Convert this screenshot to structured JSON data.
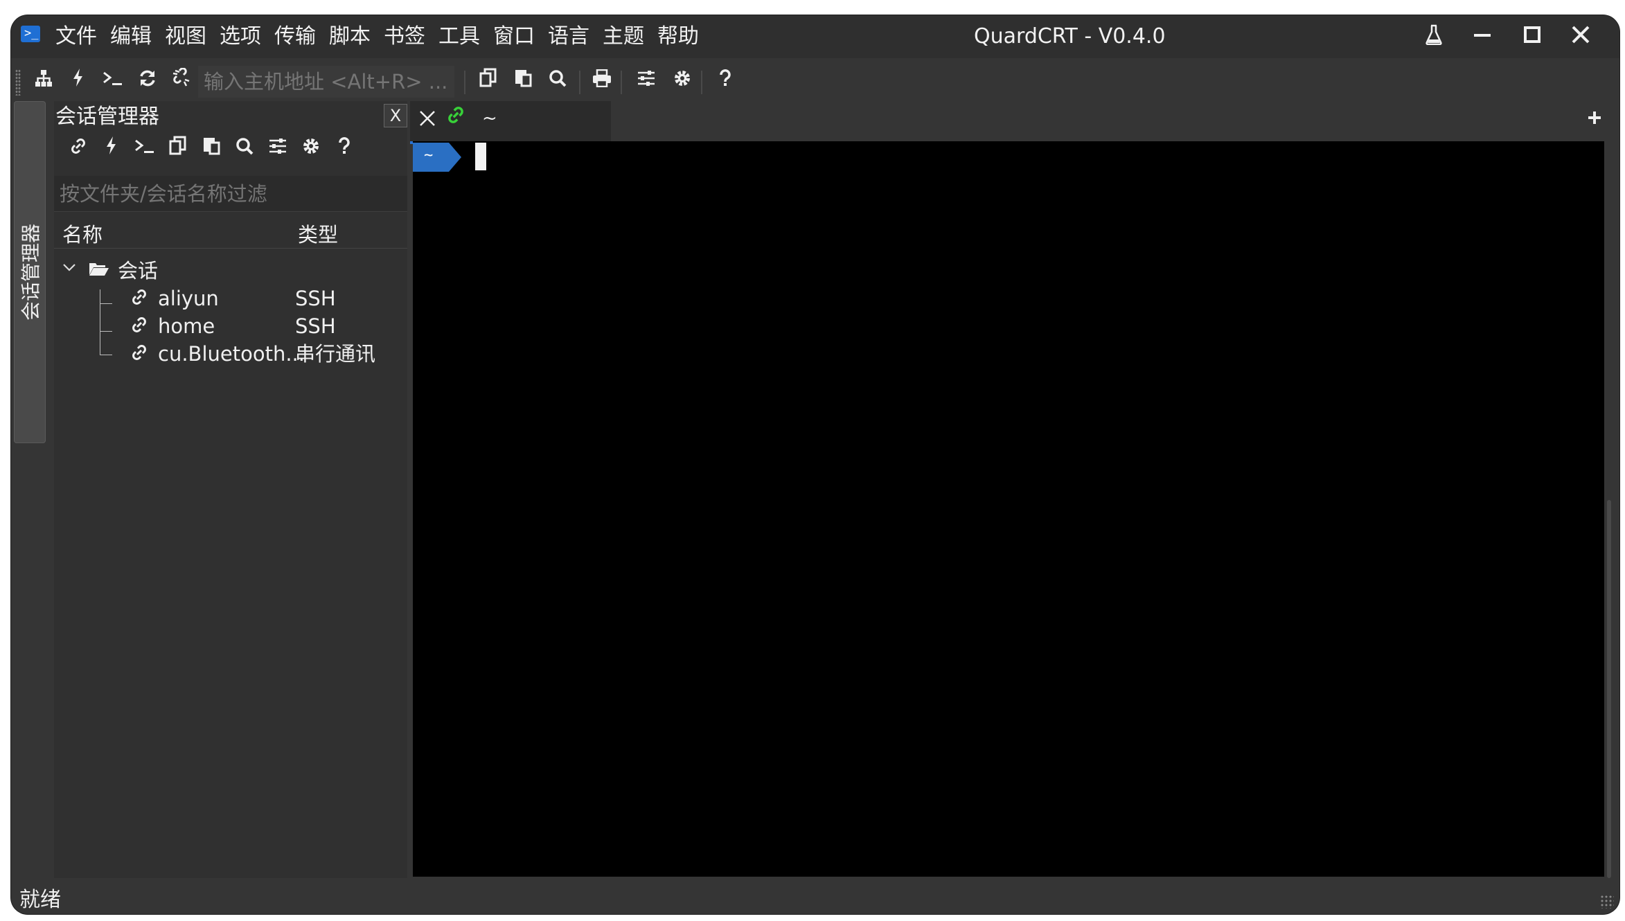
{
  "window": {
    "title": "QuardCRT - V0.4.0",
    "menu": [
      "文件",
      "编辑",
      "视图",
      "选项",
      "传输",
      "脚本",
      "书签",
      "工具",
      "窗口",
      "语言",
      "主题",
      "帮助"
    ]
  },
  "toolbar": {
    "host_placeholder": "输入主机地址 <Alt+R> ...",
    "icons": [
      "sitemap-icon",
      "bolt-icon",
      "terminal-icon",
      "refresh-icon",
      "disconnect-icon",
      "copy-icon",
      "paste-icon",
      "search-icon",
      "print-icon",
      "sliders-icon",
      "gear-icon",
      "help-icon"
    ]
  },
  "dock": {
    "session_tab_label": "会话管理器"
  },
  "session_manager": {
    "title": "会话管理器",
    "close_label": "X",
    "filter_placeholder": "按文件夹/会话名称过滤",
    "columns": {
      "name": "名称",
      "type": "类型"
    },
    "folder": {
      "label": "会话"
    },
    "sessions": [
      {
        "name": "aliyun",
        "type": "SSH"
      },
      {
        "name": "home",
        "type": "SSH"
      },
      {
        "name": "cu.Bluetooth...",
        "type": "串行通讯"
      }
    ]
  },
  "terminal": {
    "tab_label": "~",
    "prompt_label": "~",
    "link_color": "#38d139",
    "accent": "#2a73d4"
  },
  "status": {
    "text": "就绪"
  }
}
